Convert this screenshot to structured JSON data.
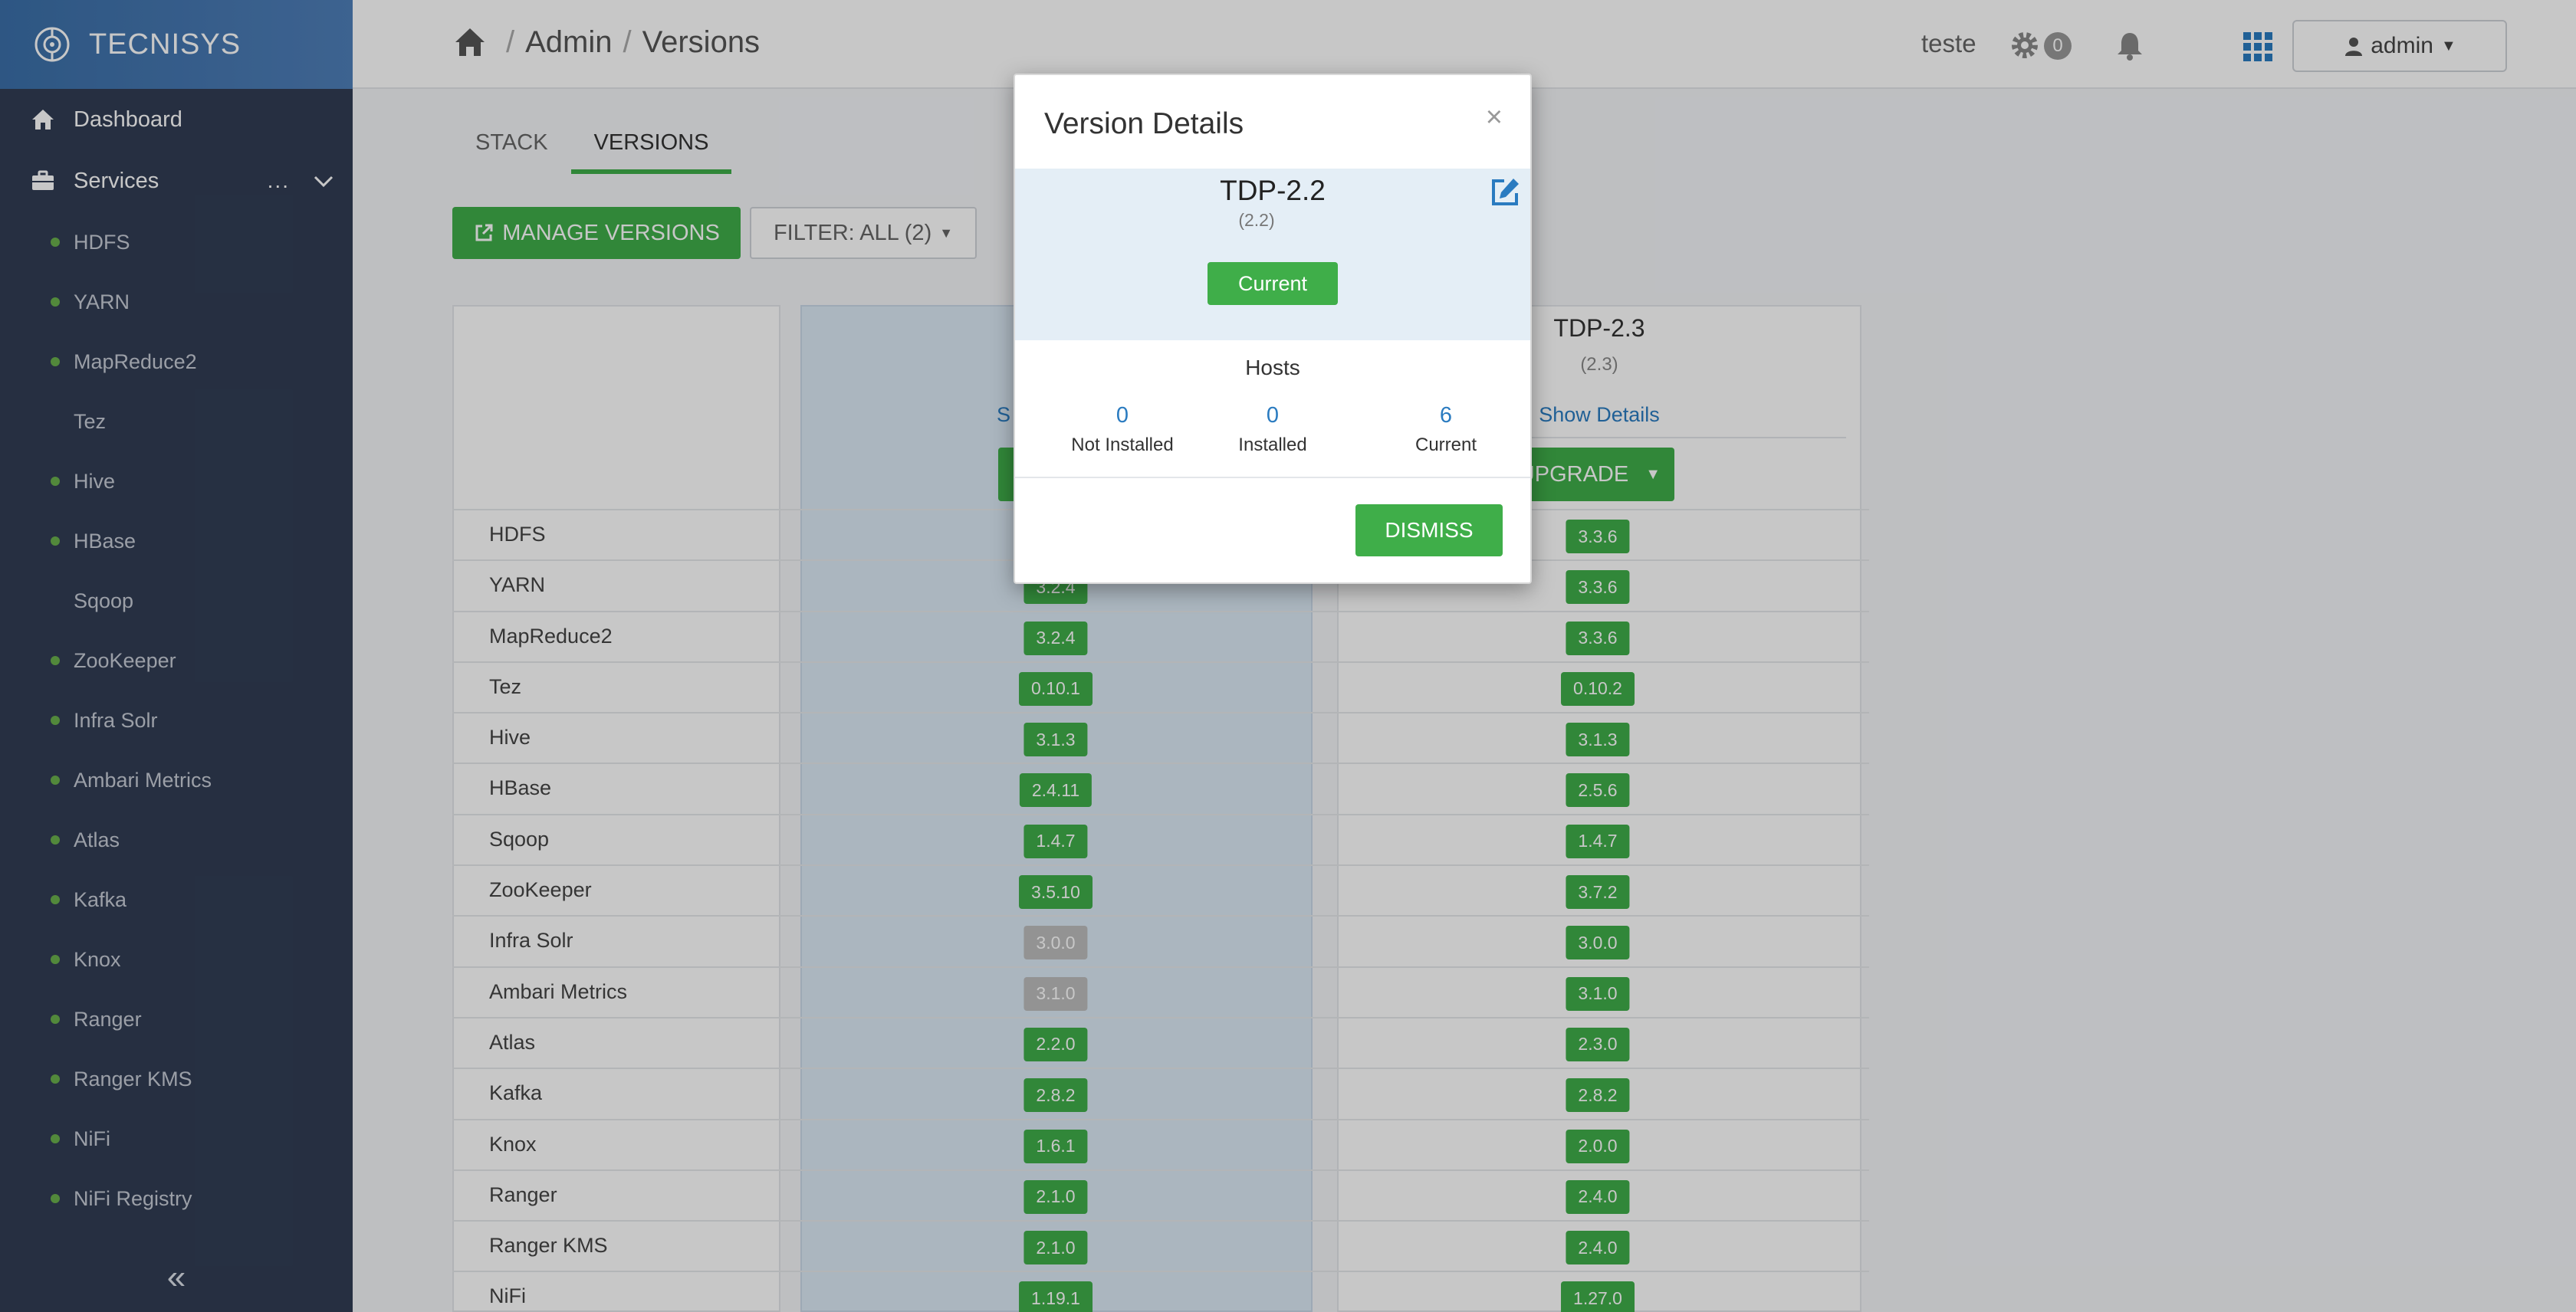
{
  "app": {
    "brand": "TECNISYS",
    "nav": {
      "dashboard": "Dashboard",
      "services": "Services",
      "services_more": "...",
      "collapse": "«"
    },
    "services": [
      {
        "name": "HDFS",
        "dot": true
      },
      {
        "name": "YARN",
        "dot": true
      },
      {
        "name": "MapReduce2",
        "dot": true
      },
      {
        "name": "Tez",
        "dot": false
      },
      {
        "name": "Hive",
        "dot": true
      },
      {
        "name": "HBase",
        "dot": true
      },
      {
        "name": "Sqoop",
        "dot": false
      },
      {
        "name": "ZooKeeper",
        "dot": true
      },
      {
        "name": "Infra Solr",
        "dot": true
      },
      {
        "name": "Ambari Metrics",
        "dot": true
      },
      {
        "name": "Atlas",
        "dot": true
      },
      {
        "name": "Kafka",
        "dot": true
      },
      {
        "name": "Knox",
        "dot": true
      },
      {
        "name": "Ranger",
        "dot": true
      },
      {
        "name": "Ranger KMS",
        "dot": true
      },
      {
        "name": "NiFi",
        "dot": true
      },
      {
        "name": "NiFi Registry",
        "dot": true
      }
    ]
  },
  "header": {
    "breadcrumb": [
      "Admin",
      "Versions"
    ],
    "breadcrumb_sep": "/",
    "cluster_name": "teste",
    "alerts_count": "0",
    "user": "admin"
  },
  "content": {
    "tabs": [
      "STACK",
      "VERSIONS"
    ],
    "manage_versions": "MANAGE VERSIONS",
    "filter": "FILTER: ALL (2)",
    "col2": {
      "title": "TDP-2.3",
      "subtitle": "(2.3)",
      "show_details": "Show Details",
      "action": "UPGRADE"
    },
    "col1_link_fragment": "S",
    "rows": [
      {
        "name": "HDFS",
        "v1": "",
        "v2": "3.3.6",
        "g1": false
      },
      {
        "name": "YARN",
        "v1": "3.2.4",
        "v2": "3.3.6",
        "g1": false
      },
      {
        "name": "MapReduce2",
        "v1": "3.2.4",
        "v2": "3.3.6",
        "g1": false
      },
      {
        "name": "Tez",
        "v1": "0.10.1",
        "v2": "0.10.2",
        "g1": false
      },
      {
        "name": "Hive",
        "v1": "3.1.3",
        "v2": "3.1.3",
        "g1": false
      },
      {
        "name": "HBase",
        "v1": "2.4.11",
        "v2": "2.5.6",
        "g1": false
      },
      {
        "name": "Sqoop",
        "v1": "1.4.7",
        "v2": "1.4.7",
        "g1": false
      },
      {
        "name": "ZooKeeper",
        "v1": "3.5.10",
        "v2": "3.7.2",
        "g1": false
      },
      {
        "name": "Infra Solr",
        "v1": "3.0.0",
        "v2": "3.0.0",
        "g1": true
      },
      {
        "name": "Ambari Metrics",
        "v1": "3.1.0",
        "v2": "3.1.0",
        "g1": true
      },
      {
        "name": "Atlas",
        "v1": "2.2.0",
        "v2": "2.3.0",
        "g1": false
      },
      {
        "name": "Kafka",
        "v1": "2.8.2",
        "v2": "2.8.2",
        "g1": false
      },
      {
        "name": "Knox",
        "v1": "1.6.1",
        "v2": "2.0.0",
        "g1": false
      },
      {
        "name": "Ranger",
        "v1": "2.1.0",
        "v2": "2.4.0",
        "g1": false
      },
      {
        "name": "Ranger KMS",
        "v1": "2.1.0",
        "v2": "2.4.0",
        "g1": false
      },
      {
        "name": "NiFi",
        "v1": "1.19.1",
        "v2": "1.27.0",
        "g1": false
      }
    ]
  },
  "modal": {
    "title": "Version Details",
    "close": "×",
    "version_name": "TDP-2.2",
    "version_sub": "(2.2)",
    "status_label": "Current",
    "hosts_title": "Hosts",
    "hosts": [
      {
        "count": "0",
        "label": "Not Installed"
      },
      {
        "count": "0",
        "label": "Installed"
      },
      {
        "count": "6",
        "label": "Current"
      }
    ],
    "dismiss": "DISMISS"
  },
  "colors": {
    "accent": "#3fae49",
    "link": "#2a7bc0",
    "sidebar": "#313d54"
  }
}
